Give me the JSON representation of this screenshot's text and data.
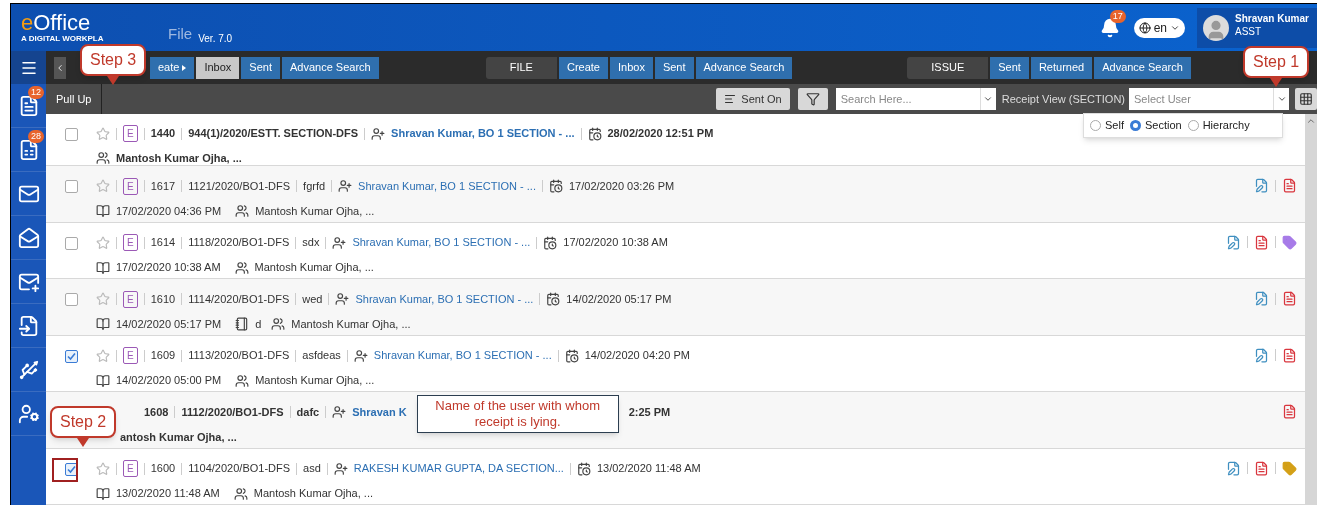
{
  "header": {
    "logo_e": "e",
    "logo_rest": "Office",
    "tagline": "A DIGITAL WORKPLA",
    "module": "File",
    "version": "Ver. 7.0",
    "notifications": "17",
    "language": "en",
    "user_name": "Shravan Kumar",
    "user_role": "ASST"
  },
  "sidebar": {
    "items": [
      {
        "kind": "receipt",
        "badge": "12"
      },
      {
        "kind": "file",
        "badge": "28"
      },
      {
        "kind": "dak"
      },
      {
        "kind": "inbox"
      },
      {
        "kind": "notice"
      },
      {
        "kind": "transfer"
      },
      {
        "kind": "dsc"
      },
      {
        "kind": "settings"
      }
    ]
  },
  "nav": {
    "groups": [
      {
        "has_back": true,
        "tabs": [
          {
            "label": "eate",
            "has_menu": true,
            "selected": false
          },
          {
            "label": "Inbox",
            "selected": true
          },
          {
            "label": "Sent",
            "selected": false
          },
          {
            "label": "Advance Search",
            "selected": false
          }
        ]
      },
      {
        "title": "FILE",
        "tabs": [
          {
            "label": "Create",
            "selected": false
          },
          {
            "label": "Inbox",
            "selected": false
          },
          {
            "label": "Sent",
            "selected": false
          },
          {
            "label": "Advance Search",
            "selected": false
          }
        ]
      },
      {
        "title": "ISSUE",
        "tabs": [
          {
            "label": "Sent",
            "selected": false
          },
          {
            "label": "Returned",
            "selected": false
          },
          {
            "label": "Advance Search",
            "selected": false
          }
        ]
      }
    ]
  },
  "toolbar": {
    "title": "Pull Up",
    "sort_button": "Sent On",
    "search_placeholder": "Search Here...",
    "view_label": "Receipt View (SECTION)",
    "user_placeholder": "Select User"
  },
  "view_options": [
    {
      "label": "Self",
      "selected": false
    },
    {
      "label": "Section",
      "selected": true
    },
    {
      "label": "Hierarchy",
      "selected": false
    }
  ],
  "rows": [
    {
      "checked": false,
      "type": "E",
      "id": "1440",
      "number": "944(1)/2020/ESTT. SECTION-DFS",
      "sender": "Shravan Kumar, BO 1 SECTION - ...",
      "date": "28/02/2020 12:51 PM",
      "recipients": "Mantosh Kumar Ojha, ...",
      "unread": true
    },
    {
      "checked": false,
      "type": "E",
      "id": "1617",
      "number": "1121/2020/BO1-DFS",
      "subject": "fgrfd",
      "sender": "Shravan Kumar, BO 1 SECTION - ...",
      "date": "17/02/2020 03:26 PM",
      "read_date": "17/02/2020 04:36 PM",
      "recipients": "Mantosh Kumar Ojha, ...",
      "unread": false,
      "attachments": [
        {
          "kind": "edit"
        },
        {
          "kind": "pdf"
        }
      ]
    },
    {
      "checked": false,
      "type": "E",
      "id": "1614",
      "number": "1118/2020/BO1-DFS",
      "subject": "sdx",
      "sender": "Shravan Kumar, BO 1 SECTION - ...",
      "date": "17/02/2020 10:38 AM",
      "read_date": "17/02/2020 10:38 AM",
      "recipients": "Mantosh Kumar Ojha, ...",
      "unread": false,
      "attachments": [
        {
          "kind": "edit"
        },
        {
          "kind": "pdf"
        },
        {
          "kind": "tag",
          "color": "#a77be8"
        }
      ]
    },
    {
      "checked": false,
      "type": "E",
      "id": "1610",
      "number": "1114/2020/BO1-DFS",
      "subject": "wed",
      "sender": "Shravan Kumar, BO 1 SECTION - ...",
      "date": "14/02/2020 05:17 PM",
      "read_date": "14/02/2020 05:17 PM",
      "note": "d",
      "recipients": "Mantosh Kumar Ojha, ...",
      "unread": false,
      "attachments": [
        {
          "kind": "edit"
        },
        {
          "kind": "pdf"
        }
      ]
    },
    {
      "checked": true,
      "type": "E",
      "id": "1609",
      "number": "1113/2020/BO1-DFS",
      "subject": "asfdeas",
      "sender": "Shravan Kumar, BO 1 SECTION - ...",
      "date": "14/02/2020 04:20 PM",
      "read_date": "14/02/2020 05:00 PM",
      "recipients": "Mantosh Kumar Ojha, ...",
      "unread": false,
      "attachments": [
        {
          "kind": "edit"
        },
        {
          "kind": "pdf"
        }
      ]
    },
    {
      "annotation": "Name of the user with whom receipt is lying.",
      "id": "1608",
      "number": "1112/2020/BO1-DFS",
      "subject": "dafc",
      "sender": "Shravan K",
      "date": "2:25 PM",
      "recipients": "antosh Kumar Ojha, ...",
      "unread": true,
      "attachments": [
        {
          "kind": "pdf"
        }
      ]
    },
    {
      "checked": true,
      "type": "E",
      "id": "1600",
      "number": "1104/2020/BO1-DFS",
      "subject": "asd",
      "sender": "RAKESH KUMAR GUPTA, DA SECTION...",
      "date": "13/02/2020 11:48 AM",
      "read_date": "13/02/2020 11:48 AM",
      "recipients": "Mantosh Kumar Ojha, ...",
      "unread": false,
      "attachments": [
        {
          "kind": "edit"
        },
        {
          "kind": "pdf"
        },
        {
          "kind": "tag",
          "color": "#d4a017"
        }
      ]
    }
  ],
  "callouts": {
    "step_3": "Step 3",
    "step_1": "Step 1",
    "step_2": "Step 2"
  }
}
